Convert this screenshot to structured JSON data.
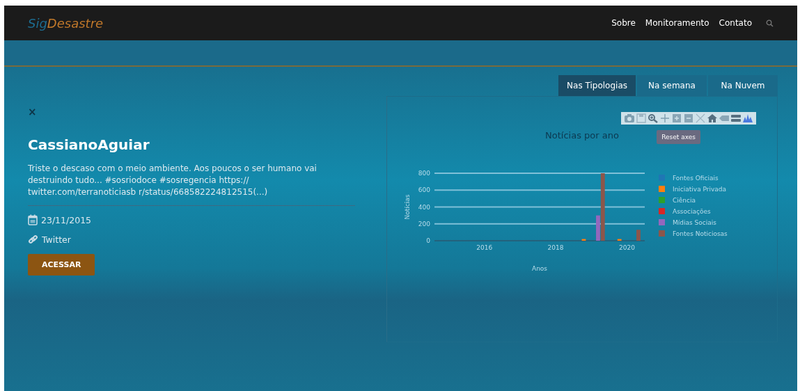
{
  "navbar": {
    "logo": {
      "prefix": "Sig",
      "suffix": "Desastre"
    },
    "links": [
      "Sobre",
      "Monitoramento",
      "Contato"
    ]
  },
  "post": {
    "close": "×",
    "author": "CassianoAguiar",
    "text": "Triste o descaso com o meio ambiente. Aos poucos o ser humano vai destruindo tudo... #sosriodoce #sosregencia https:// twitter.com/terranoticiasb r/status/668582224812515(...)",
    "date": "23/11/2015",
    "source": "Twitter",
    "button": "ACESSAR"
  },
  "tabs": [
    {
      "label": "Nas Tipologias",
      "selected": true
    },
    {
      "label": "Na semana",
      "selected": false
    },
    {
      "label": "Na Nuvem",
      "selected": false
    }
  ],
  "tooltip": "Reset axes",
  "chart_data": {
    "type": "bar",
    "title": "Notícias por ano",
    "xlabel": "Anos",
    "ylabel": "Notícias",
    "x": [
      2019,
      2020
    ],
    "xlim": [
      2014.6,
      2020.5
    ],
    "ylim": [
      0,
      800
    ],
    "grid": true,
    "legend": true,
    "xticks": [
      2016,
      2018,
      2020
    ],
    "yticks": [
      0,
      200,
      400,
      600,
      800
    ],
    "series": [
      {
        "name": "Fontes Oficiais",
        "color": "#1f77b4",
        "values": [
          0,
          0
        ]
      },
      {
        "name": "Iniciativa Privada",
        "color": "#ff7f0e",
        "values": [
          20,
          20
        ]
      },
      {
        "name": "Ciência",
        "color": "#2ca02c",
        "values": [
          0,
          0
        ]
      },
      {
        "name": "Associações",
        "color": "#d62728",
        "values": [
          0,
          0
        ]
      },
      {
        "name": "Mídias Sociais",
        "color": "#9467bd",
        "values": [
          300,
          0
        ]
      },
      {
        "name": "Fontes Noticiosas",
        "color": "#8c564b",
        "values": [
          800,
          130
        ]
      }
    ]
  }
}
